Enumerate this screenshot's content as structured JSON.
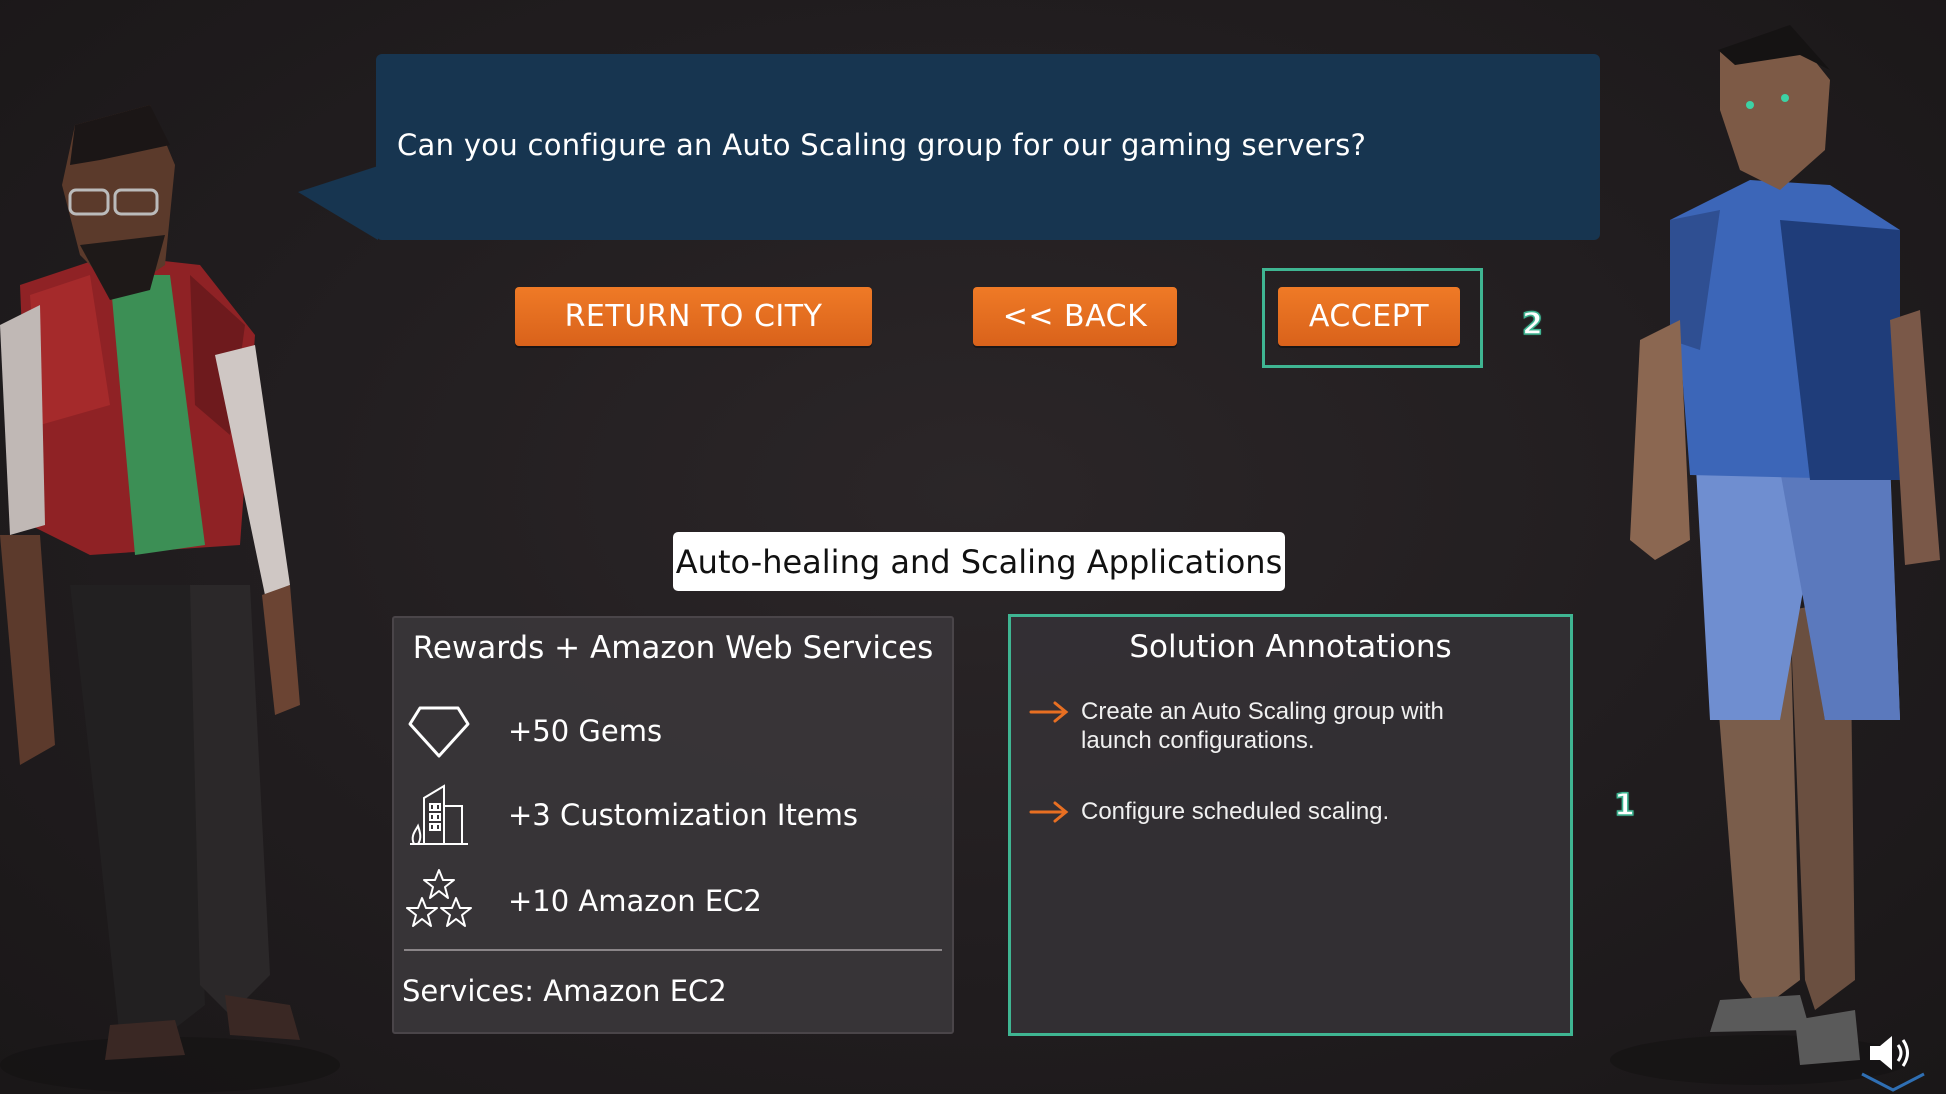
{
  "dialog": {
    "speech": "Can you configure an Auto Scaling group for our gaming servers?",
    "bubble_color": "#173550"
  },
  "buttons": {
    "return_label": "RETURN TO CITY",
    "back_label": "<< BACK",
    "accept_label": "ACCEPT",
    "button_color": "#e86f22"
  },
  "markers": {
    "accept_marker": "2",
    "annotations_marker": "1",
    "highlight_color": "#3fb592"
  },
  "quest_title": "Auto-healing and Scaling Applications",
  "rewards": {
    "title": "Rewards + Amazon Web Services",
    "items": [
      {
        "icon": "gem-icon",
        "label": "+50 Gems"
      },
      {
        "icon": "building-icon",
        "label": "+3 Customization Items"
      },
      {
        "icon": "stars-icon",
        "label": "+10 Amazon EC2"
      }
    ],
    "services": "Services: Amazon EC2"
  },
  "annotations": {
    "title": "Solution Annotations",
    "items": [
      {
        "icon": "arrow-right-icon",
        "text": "Create an Auto Scaling group with launch configurations."
      },
      {
        "icon": "arrow-right-icon",
        "text": "Configure scheduled scaling."
      }
    ],
    "arrow_color": "#e86f22"
  },
  "controls": {
    "sound_icon": "speaker-icon"
  }
}
